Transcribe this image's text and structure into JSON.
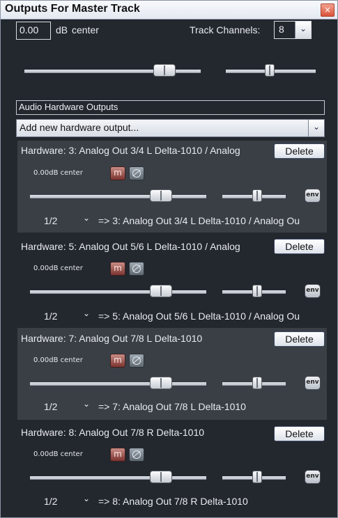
{
  "window": {
    "title": "Outputs For Master Track",
    "close_glyph": "×"
  },
  "master": {
    "volume_value": "0.00",
    "db_label": "dB",
    "pan_label": "center",
    "track_channels_label": "Track Channels:",
    "track_channels_value": "8"
  },
  "hardware_outputs": {
    "group_label": "Audio Hardware Outputs",
    "add_output_select": "Add new hardware output..."
  },
  "sends": [
    {
      "header": "Hardware: 3: Analog Out 3/4 L Delta-1010 / Analog",
      "delete_label": "Delete",
      "status": "0.00dB center",
      "mute_label": "m",
      "env_label": "env",
      "channels_value": "1/2",
      "route_text": "=> 3: Analog Out 3/4 L Delta-1010 / Analog Ou"
    },
    {
      "header": "Hardware: 5: Analog Out 5/6 L Delta-1010 / Analog",
      "delete_label": "Delete",
      "status": "0.00dB center",
      "mute_label": "m",
      "env_label": "env",
      "channels_value": "1/2",
      "route_text": "=> 5: Analog Out 5/6 L Delta-1010 / Analog Ou"
    },
    {
      "header": "Hardware: 7: Analog Out 7/8 L Delta-1010",
      "delete_label": "Delete",
      "status": "0.00dB center",
      "mute_label": "m",
      "env_label": "env",
      "channels_value": "1/2",
      "route_text": "=> 7: Analog Out 7/8 L Delta-1010"
    },
    {
      "header": "Hardware: 8: Analog Out 7/8 R Delta-1010",
      "delete_label": "Delete",
      "status": "0.00dB center",
      "mute_label": "m",
      "env_label": "env",
      "channels_value": "1/2",
      "route_text": "=> 8: Analog Out 7/8 R Delta-1010"
    }
  ],
  "icons": {
    "chevron": "⌄",
    "dropdown_arrow": "⌄"
  }
}
